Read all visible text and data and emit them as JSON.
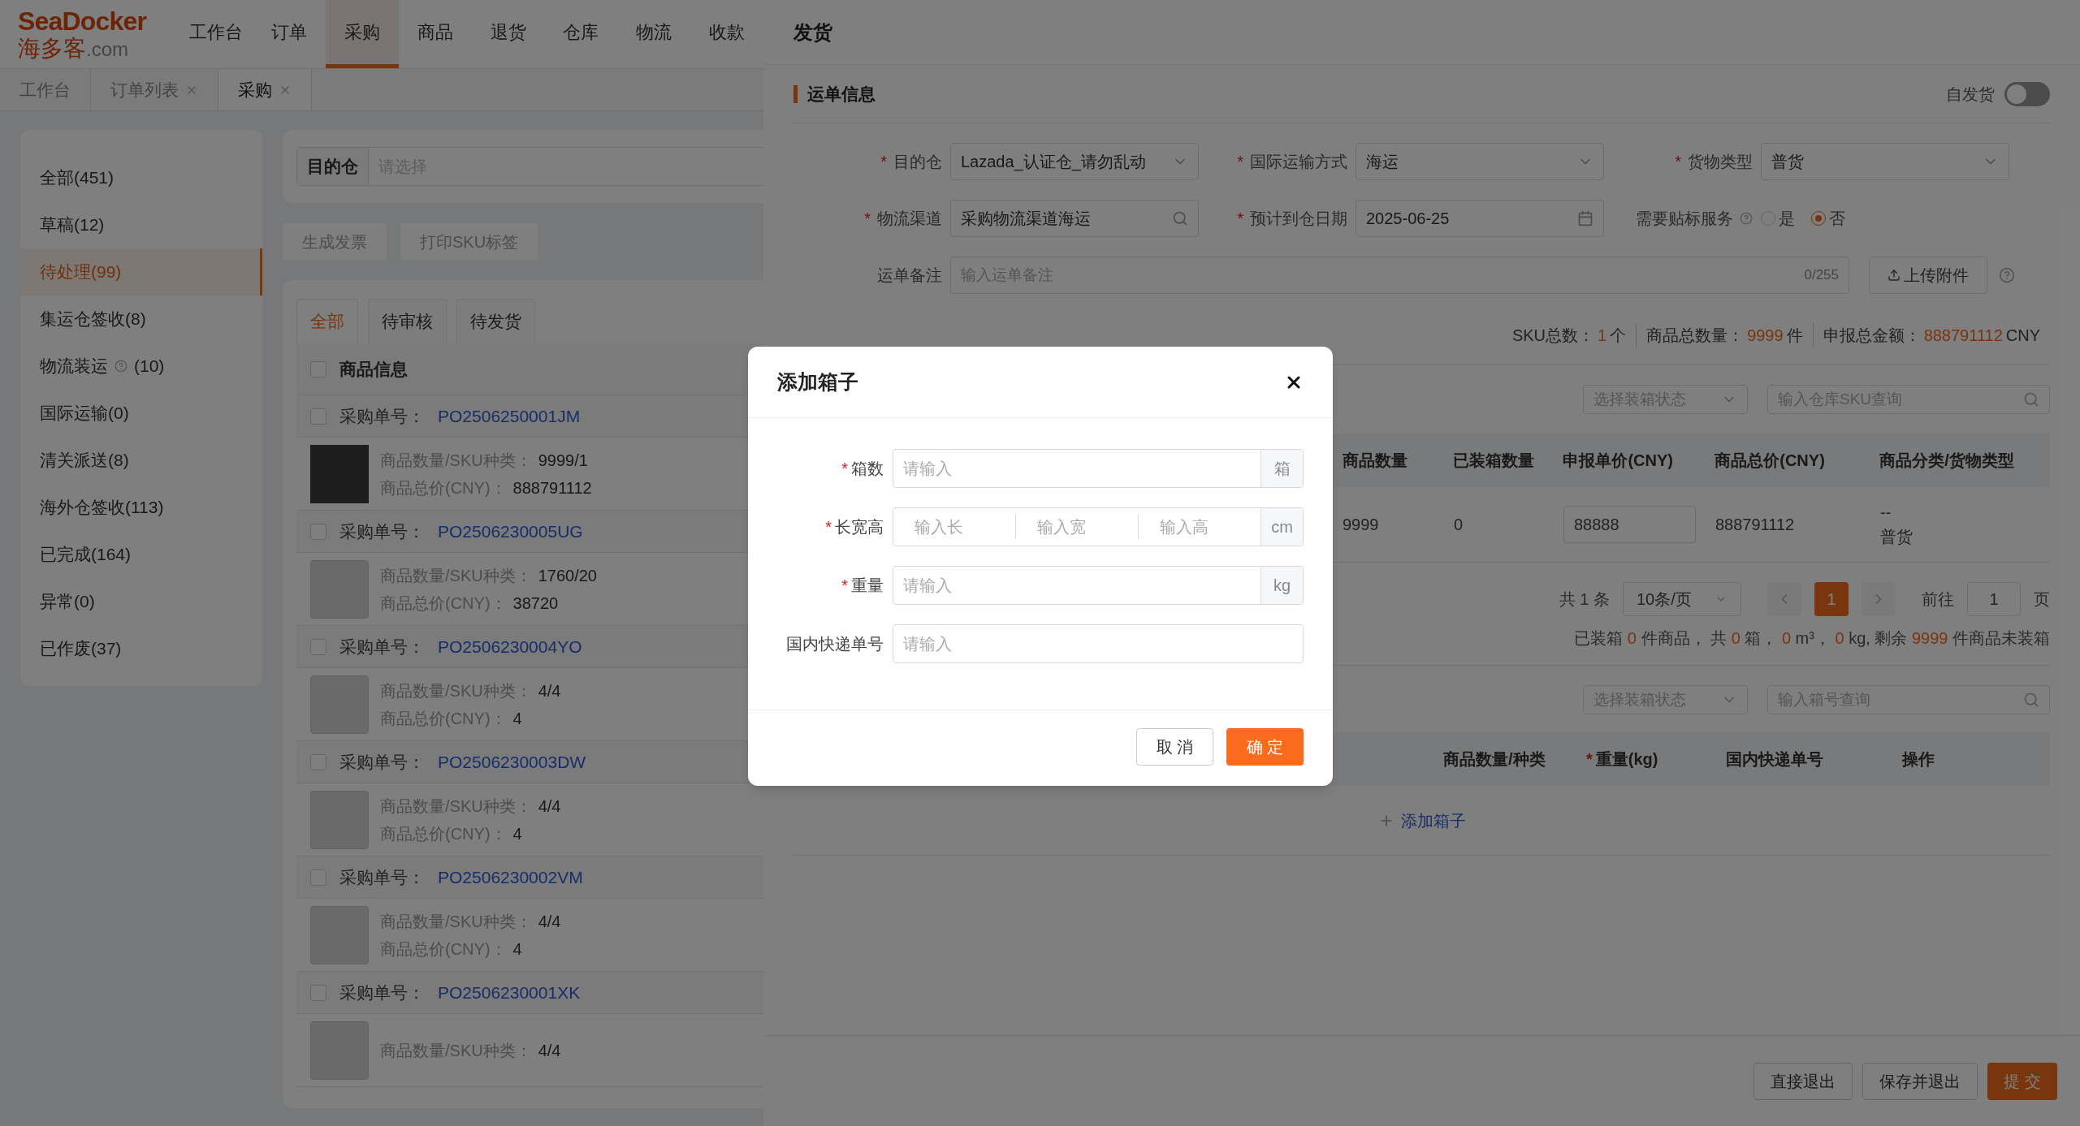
{
  "logo": {
    "name": "SeaDocker",
    "subtitle": "海多客",
    "domain": ".com"
  },
  "nav": [
    {
      "label": "工作台",
      "selected": false
    },
    {
      "label": "订单",
      "selected": false
    },
    {
      "label": "采购",
      "selected": true
    },
    {
      "label": "商品",
      "selected": false
    },
    {
      "label": "退货",
      "selected": false
    },
    {
      "label": "仓库",
      "selected": false
    },
    {
      "label": "物流",
      "selected": false
    },
    {
      "label": "收款",
      "selected": false
    }
  ],
  "open_tabs": [
    {
      "label": "工作台",
      "selected": false,
      "closable": false
    },
    {
      "label": "订单列表",
      "selected": false,
      "closable": true
    },
    {
      "label": "采购",
      "selected": true,
      "closable": true
    }
  ],
  "sidebar": [
    {
      "label": "全部(451)",
      "selected": false,
      "kind": "plain"
    },
    {
      "label": "草稿(12)",
      "selected": false,
      "kind": "plain"
    },
    {
      "label": "待处理(99)",
      "selected": true,
      "kind": "plain"
    },
    {
      "label": "集运仓签收(8)",
      "selected": false,
      "kind": "plain"
    },
    {
      "label": "物流装运",
      "count": "(10)",
      "selected": false,
      "kind": "help"
    },
    {
      "label": "国际运输(0)",
      "selected": false,
      "kind": "plain"
    },
    {
      "label": "清关派送(8)",
      "selected": false,
      "kind": "plain"
    },
    {
      "label": "海外仓签收(113)",
      "selected": false,
      "kind": "plain"
    },
    {
      "label": "已完成(164)",
      "selected": false,
      "kind": "plain"
    },
    {
      "label": "异常(0)",
      "selected": false,
      "kind": "plain"
    },
    {
      "label": "已作废(37)",
      "selected": false,
      "kind": "plain"
    }
  ],
  "filter": {
    "label": "目的仓",
    "placeholder": "请选择"
  },
  "actions": [
    "生成发票",
    "打印SKU标签"
  ],
  "status_tabs": [
    {
      "label": "全部",
      "selected": true
    },
    {
      "label": "待审核",
      "selected": false
    },
    {
      "label": "待发货",
      "selected": false
    }
  ],
  "list": {
    "header": {
      "label": "商品信息",
      "checked": false
    },
    "orders": [
      {
        "checked": false,
        "order_label": "采购单号：",
        "order_no": "PO2506250001JM",
        "qty_label": "商品数量/SKU种类：",
        "qty": "9999/1",
        "total_label": "商品总价(CNY)：",
        "total": "888791112",
        "kind": "photo"
      },
      {
        "checked": false,
        "order_label": "采购单号：",
        "order_no": "PO2506230005UG",
        "qty_label": "商品数量/SKU种类：",
        "qty": "1760/20",
        "total_label": "商品总价(CNY)：",
        "total": "38720",
        "kind": "placeholder"
      },
      {
        "checked": false,
        "order_label": "采购单号：",
        "order_no": "PO2506230004YO",
        "qty_label": "商品数量/SKU种类：",
        "qty": "4/4",
        "total_label": "商品总价(CNY)：",
        "total": "4",
        "kind": "placeholder"
      },
      {
        "checked": false,
        "order_label": "采购单号：",
        "order_no": "PO2506230003DW",
        "qty_label": "商品数量/SKU种类：",
        "qty": "4/4",
        "total_label": "商品总价(CNY)：",
        "total": "4",
        "kind": "placeholder"
      },
      {
        "checked": false,
        "order_label": "采购单号：",
        "order_no": "PO2506230002VM",
        "qty_label": "商品数量/SKU种类：",
        "qty": "4/4",
        "total_label": "商品总价(CNY)：",
        "total": "4",
        "kind": "placeholder"
      },
      {
        "checked": false,
        "order_label": "采购单号：",
        "order_no": "PO2506230001XK",
        "qty_label": "商品数量/SKU种类：",
        "qty": "4/4",
        "kind": "placeholder"
      }
    ]
  },
  "drawer": {
    "title": "发货",
    "waybill": {
      "title": "运单信息",
      "toggle_label": "自发货",
      "toggle_on": false,
      "fields": [
        {
          "mark": "*",
          "label": "目的仓",
          "kind": "select",
          "value": "Lazada_认证仓_请勿乱动"
        },
        {
          "mark": "*",
          "label": "国际运输方式",
          "kind": "select",
          "value": "海运"
        },
        {
          "mark": "*",
          "label": "货物类型",
          "kind": "select",
          "value": "普货"
        },
        {
          "mark": "*",
          "label": "物流渠道",
          "kind": "search",
          "value": "采购物流渠道海运"
        },
        {
          "mark": "*",
          "label": "预计到仓日期",
          "kind": "date",
          "value": "2025-06-25"
        },
        {
          "label": "需要贴标服务",
          "kind": "radio",
          "options": [
            {
              "label": "是",
              "selected": false
            },
            {
              "label": "否",
              "selected": true
            }
          ]
        }
      ],
      "remark": {
        "label": "运单备注",
        "placeholder": "输入运单备注",
        "counter": "0/255"
      },
      "upload": "上传附件"
    },
    "goods": {
      "summary": [
        {
          "label": "SKU总数：",
          "value": "1",
          "unit": "个"
        },
        {
          "label": "商品总数量：",
          "value": "9999",
          "unit": "件"
        },
        {
          "label": "申报总金额：",
          "value": "888791112",
          "unit": "CNY"
        }
      ],
      "status_placeholder": "选择装箱状态",
      "search_placeholder": "输入仓库SKU查询",
      "columns": [
        "商品数量",
        "已装箱数量",
        "申报单价(CNY)",
        "商品总价(CNY)",
        "商品分类/货物类型"
      ],
      "row": {
        "qty": "9999",
        "packed": "0",
        "price": "88888",
        "total": "888791112",
        "category": "--",
        "cargo_type": "普货"
      },
      "pagination": {
        "total": "共 1 条",
        "page_size": "10条/页",
        "pages": [
          {
            "label": "1",
            "selected": true
          }
        ],
        "goto_label": "前往",
        "goto_value": "1",
        "goto_unit": "页"
      },
      "packed_summary": [
        {
          "text": "已装箱 ",
          "em": false
        },
        {
          "text": "0",
          "em": true
        },
        {
          "text": " 件商品， 共 ",
          "em": false
        },
        {
          "text": "0",
          "em": true
        },
        {
          "text": " 箱， ",
          "em": false
        },
        {
          "text": "0",
          "em": true
        },
        {
          "text": " m³， ",
          "em": false
        },
        {
          "text": "0",
          "em": true
        },
        {
          "text": " kg, 剩余 ",
          "em": false
        },
        {
          "text": "9999",
          "em": true
        },
        {
          "text": " 件商品未装箱",
          "em": false
        }
      ]
    },
    "boxes": {
      "status_placeholder": "选择装箱状态",
      "search_placeholder": "输入箱号查询",
      "columns": [
        {
          "label": "商品数量/种类"
        },
        {
          "mark": "*",
          "label": "重量(kg)"
        },
        {
          "label": "国内快递单号"
        },
        {
          "label": "操作"
        }
      ],
      "add_link": "添加箱子"
    },
    "footer": [
      {
        "label": "直接退出",
        "kind": "default"
      },
      {
        "label": "保存并退出",
        "kind": "default"
      },
      {
        "label": "提 交",
        "kind": "primary"
      }
    ]
  },
  "modal": {
    "title": "添加箱子",
    "fields": [
      {
        "mark": "*",
        "label": "箱数",
        "kind": "single",
        "placeholder": "请输入",
        "suffix": "箱"
      },
      {
        "mark": "*",
        "label": "长宽高",
        "kind": "triple",
        "placeholders": [
          "输入长",
          "输入宽",
          "输入高"
        ],
        "suffix": "cm"
      },
      {
        "mark": "*",
        "label": "重量",
        "kind": "single",
        "placeholder": "请输入",
        "suffix": "kg"
      },
      {
        "label": "国内快递单号",
        "kind": "single",
        "placeholder": "请输入"
      }
    ],
    "buttons": [
      {
        "label": "取 消",
        "kind": "default"
      },
      {
        "label": "确 定",
        "kind": "primary"
      }
    ]
  }
}
